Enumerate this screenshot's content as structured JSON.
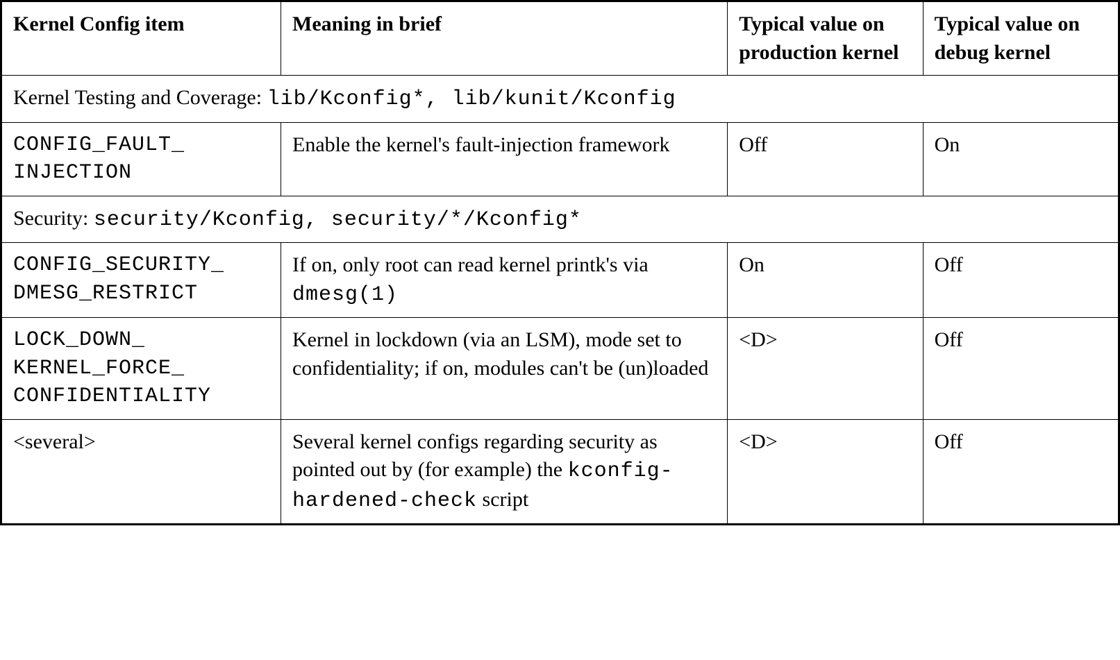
{
  "headers": {
    "config": "Kernel Config item",
    "meaning": "Meaning in brief",
    "prod": "Typical value on production kernel",
    "debug": "Typical value on debug kernel"
  },
  "sections": [
    {
      "title_prefix": "Kernel Testing and Coverage: ",
      "title_mono": "lib/Kconfig*, lib/kunit/Kconfig",
      "rows": [
        {
          "config": "CONFIG_FAULT_ INJECTION",
          "meaning_parts": [
            {
              "text": "Enable the kernel's fault-injection framework",
              "mono": false
            }
          ],
          "prod": "Off",
          "debug": "On"
        }
      ]
    },
    {
      "title_prefix": "Security: ",
      "title_mono": "security/Kconfig, security/*/Kconfig*",
      "rows": [
        {
          "config": "CONFIG_SECURITY_ DMESG_RESTRICT",
          "meaning_parts": [
            {
              "text": "If on, only root can read kernel printk's via ",
              "mono": false
            },
            {
              "text": "dmesg(1)",
              "mono": true
            }
          ],
          "prod": "On",
          "debug": "Off"
        },
        {
          "config": "LOCK_DOWN_ KERNEL_FORCE_ CONFIDENTIALITY",
          "meaning_parts": [
            {
              "text": "Kernel in lockdown (via an LSM), mode set to confidentiality; if on, modules can't be (un)loaded",
              "mono": false
            }
          ],
          "prod": "<D>",
          "debug": "Off"
        },
        {
          "config_serif": "<several>",
          "meaning_parts": [
            {
              "text": "Several kernel configs regarding security as pointed out by (for example) the ",
              "mono": false
            },
            {
              "text": "kconfig-hardened-check",
              "mono": true
            },
            {
              "text": " script",
              "mono": false
            }
          ],
          "prod": "<D>",
          "debug": "Off"
        }
      ]
    }
  ]
}
